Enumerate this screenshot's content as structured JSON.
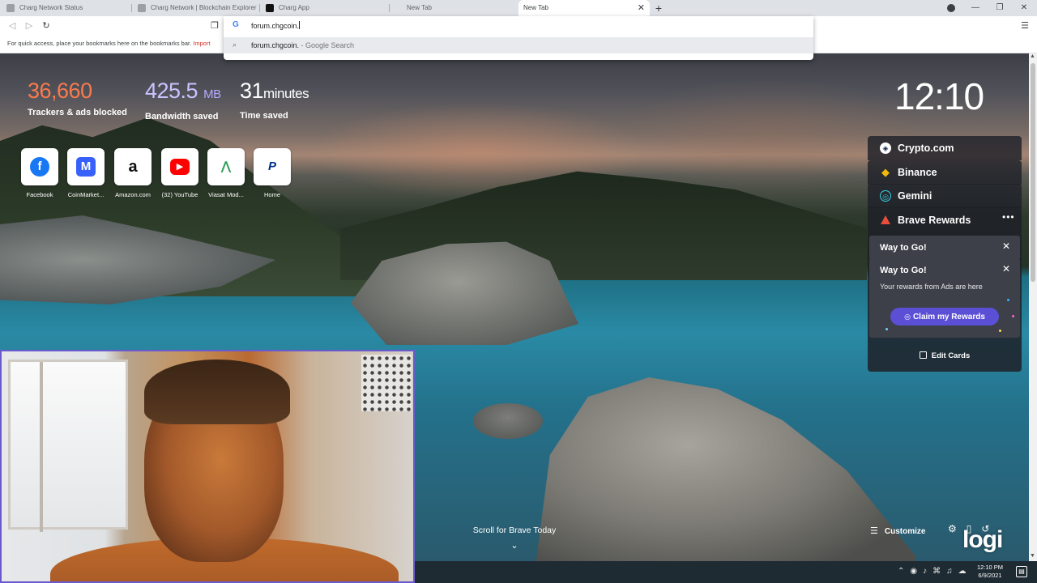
{
  "tabs": [
    {
      "title": "Charg Network Status",
      "favicon_color": "#9aa0a6",
      "active": false
    },
    {
      "title": "Charg Network | Blockchain Explorer",
      "favicon_color": "#9aa0a6",
      "active": false
    },
    {
      "title": "Charg App",
      "favicon_color": "#111111",
      "active": false
    },
    {
      "title": "New Tab",
      "active": false
    },
    {
      "title": "New Tab",
      "active": true
    }
  ],
  "toolbar": {
    "omnibox_value": "forum.chgcoin.",
    "suggestion_main": "forum.chgcoin.",
    "suggestion_sub": " - Google Search"
  },
  "bookmarks_bar": {
    "hint": "For quick access, place your bookmarks here on the bookmarks bar.",
    "import_link": "Import"
  },
  "stats": {
    "trackers": {
      "value": "36,660",
      "label": "Trackers & ads blocked"
    },
    "bandwidth": {
      "value": "425.5",
      "unit": "MB",
      "label": "Bandwidth saved"
    },
    "time": {
      "value": "31",
      "unit": "minutes",
      "label": "Time saved"
    }
  },
  "clock": "12:10",
  "top_sites": [
    {
      "label": "Facebook",
      "glyph": "f",
      "color": "#1877f2",
      "icon": "facebook-icon"
    },
    {
      "label": "CoinMarket...",
      "glyph": "M",
      "color": "#3861fb",
      "icon": "coinmarketcap-icon"
    },
    {
      "label": "Amazon.com",
      "glyph": "a",
      "color": "#111111",
      "icon": "amazon-icon"
    },
    {
      "label": "(32) YouTube",
      "glyph": "▶",
      "color": "#ff0000",
      "icon": "youtube-icon"
    },
    {
      "label": "Viasat Mod...",
      "glyph": "⋀",
      "color": "#2e9e5b",
      "icon": "viasat-icon"
    },
    {
      "label": "Home",
      "glyph": "P",
      "color": "#003087",
      "icon": "paypal-icon"
    }
  ],
  "widgets": {
    "crypto_com": "Crypto.com",
    "binance": "Binance",
    "gemini": "Gemini",
    "brave_rewards": "Brave Rewards",
    "notice_1": "Way to Go!",
    "notice_2": "Way to Go!",
    "notice_2_sub": "Your rewards from Ads are here",
    "claim_button": "Claim my Rewards",
    "edit_cards": "Edit Cards"
  },
  "footer": {
    "scroll_label": "Scroll for Brave Today",
    "customize": "Customize",
    "logo": "logi"
  },
  "taskbar": {
    "time": "12:10 PM",
    "date": "6/9/2021"
  },
  "colors": {
    "trackers": "#fb7a4d",
    "bandwidth": "#c9c2ff",
    "claim_button": "#5b4fd6",
    "rewards_triangle": "#e94e3c"
  }
}
